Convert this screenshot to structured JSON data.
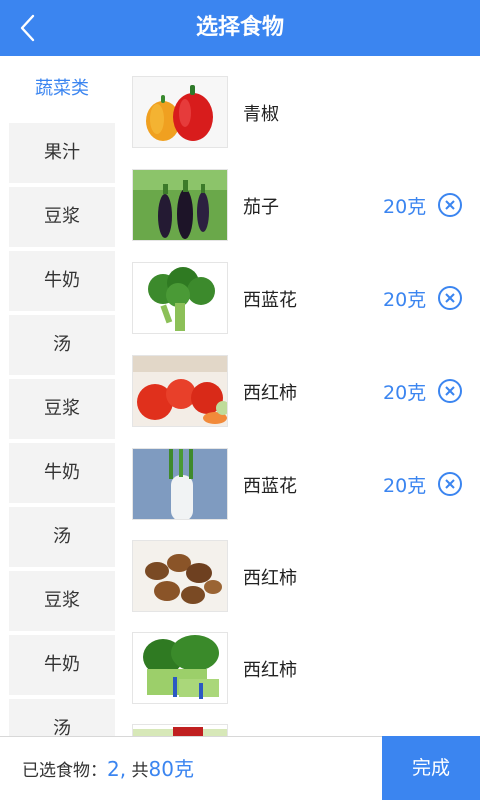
{
  "header": {
    "title": "选择食物",
    "back_icon": "chevron-left-icon"
  },
  "sidebar": {
    "items": [
      {
        "label": "蔬菜类",
        "active": true
      },
      {
        "label": "果汁"
      },
      {
        "label": "豆浆"
      },
      {
        "label": "牛奶"
      },
      {
        "label": "汤"
      },
      {
        "label": "豆浆"
      },
      {
        "label": "牛奶"
      },
      {
        "label": "汤"
      },
      {
        "label": "豆浆"
      },
      {
        "label": "牛奶"
      },
      {
        "label": "汤"
      }
    ]
  },
  "food_list": {
    "items": [
      {
        "name": "青椒",
        "amount": "",
        "image": "bell-peppers"
      },
      {
        "name": "茄子",
        "amount": "20克",
        "image": "eggplants"
      },
      {
        "name": "西蓝花",
        "amount": "20克",
        "image": "broccoli"
      },
      {
        "name": "西红柿",
        "amount": "20克",
        "image": "tomatoes"
      },
      {
        "name": "西蓝花",
        "amount": "20克",
        "image": "radish"
      },
      {
        "name": "西红柿",
        "amount": "",
        "image": "mushrooms"
      },
      {
        "name": "西红柿",
        "amount": "",
        "image": "spinach"
      },
      {
        "name": "",
        "amount": "",
        "image": "cabbage"
      }
    ]
  },
  "bottom_bar": {
    "selected_label": "已选食物：",
    "selected_count": "2,",
    "total_label": "共",
    "total_value": "80克",
    "done_label": "完成"
  },
  "colors": {
    "accent": "#3b85f0",
    "sidebar_bg": "#f3f3f3"
  }
}
